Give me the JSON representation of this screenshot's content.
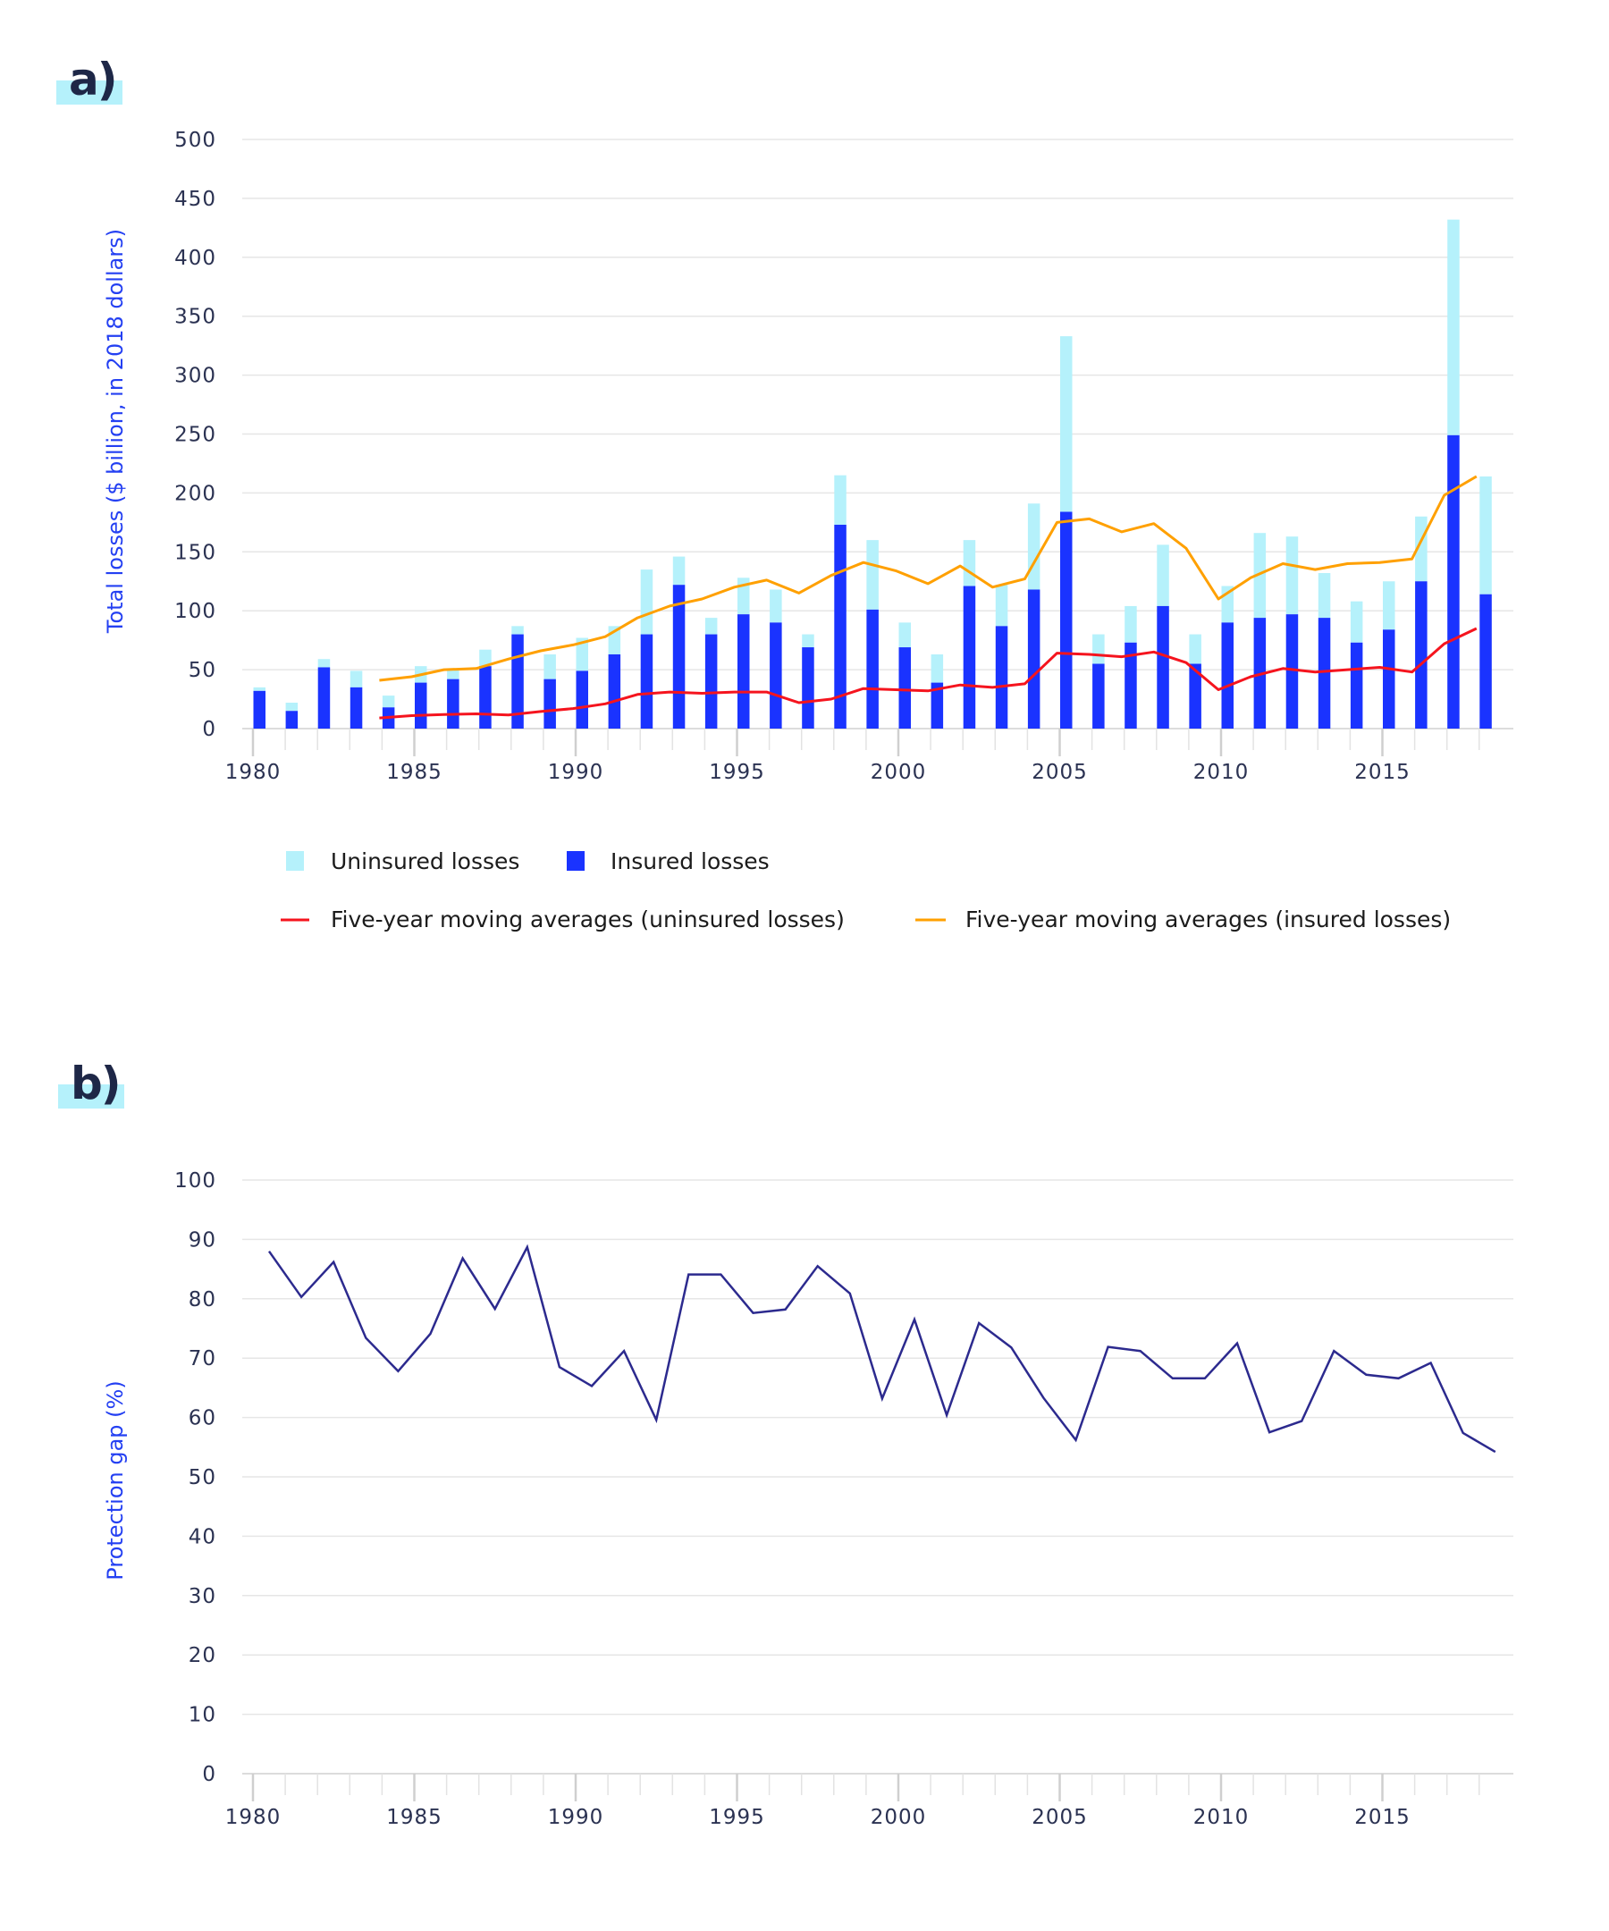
{
  "panels": {
    "a_label": "a)",
    "b_label": "b)"
  },
  "colors": {
    "uninsured": "#b5f1fb",
    "insured": "#1a33ff",
    "ma_uninsured": "#f5141e",
    "ma_insured": "#ffa000",
    "protection_gap": "#2c2a8e",
    "grid": "#e6e6e6",
    "tick_text": "#2b3252",
    "axis_title": "#2440f2"
  },
  "chart_data": [
    {
      "type": "bar",
      "stacked": true,
      "title": "",
      "xlabel": "",
      "ylabel": "Total losses ($ billion, in 2018 dollars)",
      "ylim": [
        0,
        500
      ],
      "yticks": [
        "0",
        "50",
        "100",
        "150",
        "200",
        "250",
        "300",
        "350",
        "400",
        "450",
        "500"
      ],
      "xticks": [
        "1980",
        "1985",
        "1990",
        "1995",
        "2000",
        "2005",
        "2010",
        "2015"
      ],
      "grid": true,
      "legend_position": "bottom",
      "categories": [
        1980,
        1981,
        1982,
        1983,
        1984,
        1985,
        1986,
        1987,
        1988,
        1989,
        1990,
        1991,
        1992,
        1993,
        1994,
        1995,
        1996,
        1997,
        1998,
        1999,
        2000,
        2001,
        2002,
        2003,
        2004,
        2005,
        2006,
        2007,
        2008,
        2009,
        2010,
        2011,
        2012,
        2013,
        2014,
        2015,
        2016,
        2017,
        2018
      ],
      "series": [
        {
          "name": "Insured losses",
          "kind": "bar",
          "values": [
            32,
            15,
            52,
            35,
            18,
            39,
            42,
            53,
            80,
            42,
            49,
            63,
            80,
            122,
            80,
            97,
            90,
            69,
            173,
            101,
            69,
            39,
            121,
            87,
            118,
            184,
            55,
            73,
            104,
            55,
            90,
            94,
            97,
            94,
            73,
            84,
            125,
            249,
            114
          ]
        },
        {
          "name": "Uninsured losses",
          "kind": "bar",
          "values": [
            3,
            7,
            7,
            14,
            10,
            14,
            8,
            14,
            7,
            21,
            28,
            24,
            55,
            24,
            14,
            31,
            28,
            11,
            42,
            59,
            21,
            24,
            39,
            35,
            73,
            149,
            25,
            31,
            52,
            25,
            31,
            72,
            66,
            38,
            35,
            41,
            55,
            183,
            100
          ]
        },
        {
          "name": "Five-year moving averages (uninsured losses)",
          "kind": "line",
          "x": [
            1984,
            1985,
            1986,
            1987,
            1988,
            1989,
            1990,
            1991,
            1992,
            1993,
            1994,
            1995,
            1996,
            1997,
            1998,
            1999,
            2000,
            2001,
            2002,
            2003,
            2004,
            2005,
            2006,
            2007,
            2008,
            2009,
            2010,
            2011,
            2012,
            2013,
            2014,
            2015,
            2016,
            2017,
            2018
          ],
          "values": [
            9,
            11,
            12,
            12.5,
            11.5,
            14.5,
            17,
            21,
            29,
            31,
            30,
            31,
            31,
            22,
            25,
            34,
            33,
            32,
            37,
            35,
            38,
            64,
            63,
            61,
            65,
            56,
            33,
            44,
            51,
            48,
            50,
            52,
            48,
            72,
            85
          ]
        },
        {
          "name": "Five-year moving averages (insured losses)",
          "kind": "line",
          "x": [
            1984,
            1985,
            1986,
            1987,
            1988,
            1989,
            1990,
            1991,
            1992,
            1993,
            1994,
            1995,
            1996,
            1997,
            1998,
            1999,
            2000,
            2001,
            2002,
            2003,
            2004,
            2005,
            2006,
            2007,
            2008,
            2009,
            2010,
            2011,
            2012,
            2013,
            2014,
            2015,
            2016,
            2017,
            2018
          ],
          "values": [
            41,
            44,
            50,
            51,
            59,
            66,
            71,
            78,
            94,
            104,
            110,
            120,
            126,
            115,
            130,
            141,
            134,
            123,
            138,
            120,
            127,
            175,
            178,
            167,
            174,
            153,
            110,
            128,
            140,
            135,
            140,
            141,
            144,
            198,
            214
          ]
        }
      ],
      "legend": [
        {
          "label": "Uninsured losses",
          "symbol": "square",
          "series": "uninsured"
        },
        {
          "label": "Insured losses",
          "symbol": "square",
          "series": "insured"
        },
        {
          "label": "Five-year moving averages (uninsured losses)",
          "symbol": "line",
          "series": "ma_uninsured"
        },
        {
          "label": "Five-year moving averages (insured losses)",
          "symbol": "line",
          "series": "ma_insured"
        }
      ]
    },
    {
      "type": "line",
      "title": "",
      "xlabel": "",
      "ylabel": "Protection gap (%)",
      "ylim": [
        0,
        100
      ],
      "yticks": [
        "0",
        "10",
        "20",
        "30",
        "40",
        "50",
        "60",
        "70",
        "80",
        "90",
        "100"
      ],
      "xticks": [
        "1980",
        "1985",
        "1990",
        "1995",
        "2000",
        "2005",
        "2010",
        "2015"
      ],
      "grid": true,
      "legend_position": "none",
      "x": [
        1980,
        1981,
        1982,
        1983,
        1984,
        1985,
        1986,
        1987,
        1988,
        1989,
        1990,
        1991,
        1992,
        1993,
        1994,
        1995,
        1996,
        1997,
        1998,
        1999,
        2000,
        2001,
        2002,
        2003,
        2004,
        2005,
        2006,
        2007,
        2008,
        2009,
        2010,
        2011,
        2012,
        2013,
        2014,
        2015,
        2016,
        2017,
        2018
      ],
      "series": [
        {
          "name": "Protection gap",
          "values": [
            88.0,
            80.3,
            86.2,
            73.4,
            67.8,
            74.1,
            86.8,
            78.3,
            88.7,
            68.5,
            65.3,
            71.2,
            59.6,
            84.1,
            84.1,
            77.6,
            78.2,
            85.5,
            80.9,
            63.2,
            76.5,
            60.4,
            75.9,
            71.8,
            63.3,
            56.2,
            71.9,
            71.2,
            66.6,
            66.6,
            72.5,
            57.5,
            59.4,
            71.2,
            67.2,
            66.6,
            69.2,
            57.4,
            54.2
          ]
        }
      ]
    }
  ]
}
